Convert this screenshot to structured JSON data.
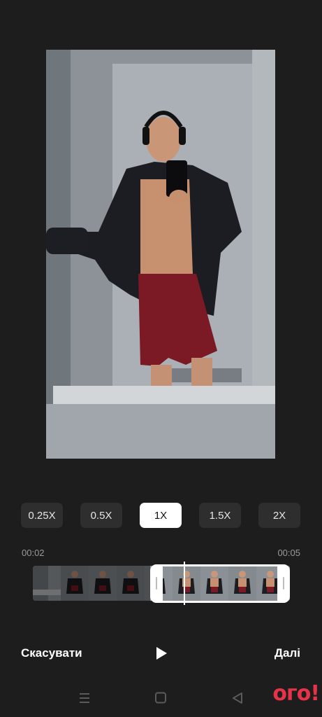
{
  "speed_options": [
    "0.25X",
    "0.5X",
    "1X",
    "1.5X",
    "2X"
  ],
  "selected_speed": "1X",
  "trim": {
    "start_time": "00:02",
    "end_time": "00:05"
  },
  "actions": {
    "cancel_label": "Скасувати",
    "next_label": "Далі"
  },
  "watermark": "ого!",
  "colors": {
    "background": "#1d1d1d",
    "selected_chip": "#ffffff",
    "chip": "#2e2e2e",
    "watermark": "#e7334a"
  },
  "icons": {
    "play": "play-icon",
    "menu": "menu-icon",
    "home": "home-icon",
    "back": "back-icon"
  }
}
